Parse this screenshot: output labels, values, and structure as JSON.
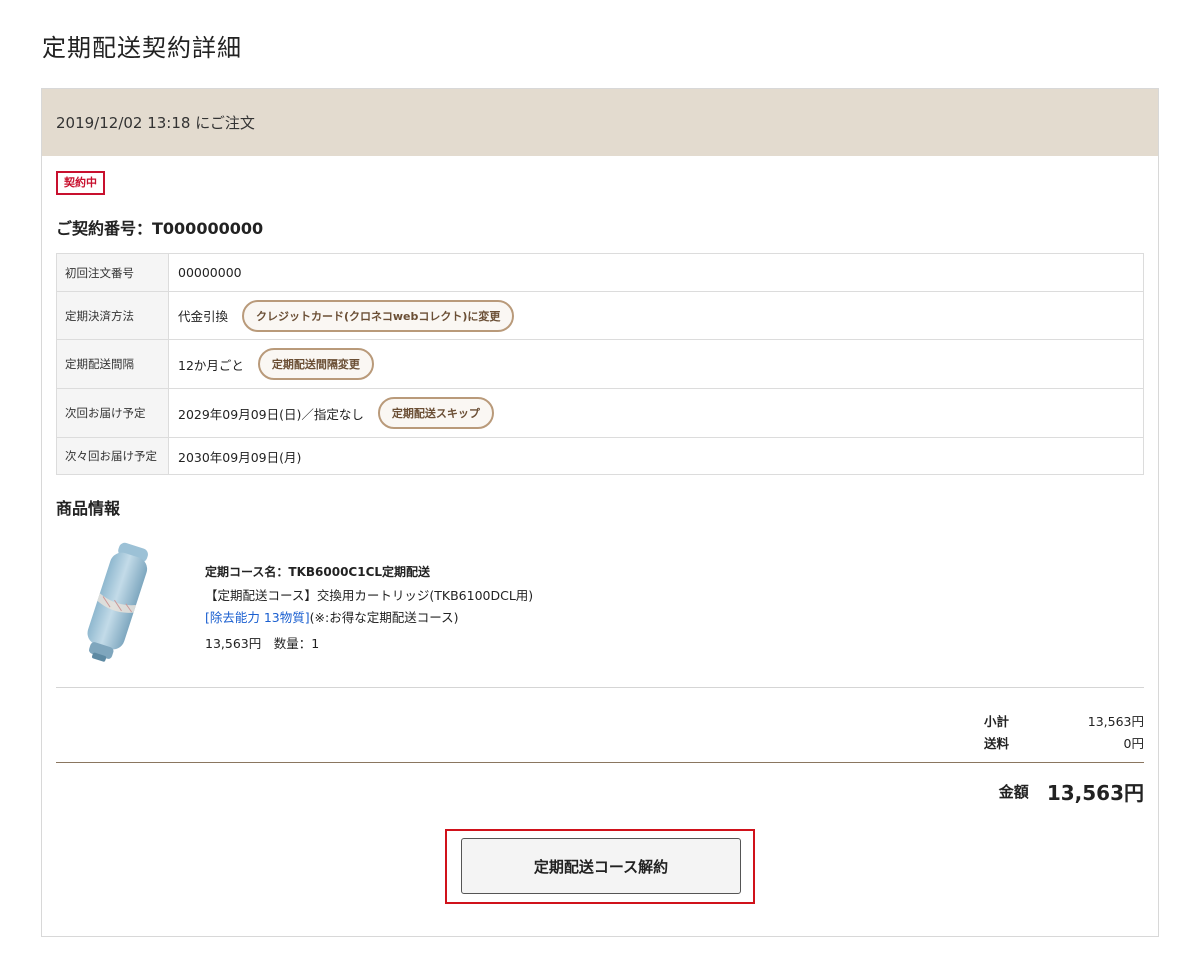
{
  "page": {
    "title": "定期配送契約詳細"
  },
  "order": {
    "header": "2019/12/02 13:18 にご注文",
    "status_badge": "契約中",
    "contract_number": "ご契約番号：T000000000"
  },
  "details": {
    "rows": [
      {
        "label": "初回注文番号",
        "value": "00000000"
      },
      {
        "label": "定期決済方法",
        "value": "代金引換",
        "button": "クレジットカード(クロネコwebコレクト)に変更"
      },
      {
        "label": "定期配送間隔",
        "value": "12か月ごと",
        "button": "定期配送間隔変更"
      },
      {
        "label": "次回お届け予定",
        "value": "2029年09月09日(日)／指定なし",
        "button": "定期配送スキップ"
      },
      {
        "label": "次々回お届け予定",
        "value": "2030年09月09日(月)"
      }
    ]
  },
  "product": {
    "section_title": "商品情報",
    "course_name": "定期コース名：TKB6000C1CL定期配送",
    "name": "【定期配送コース】交換用カートリッジ(TKB6100DCL用)",
    "link_text": "[除去能力 13物質]",
    "note": "(※:お得な定期配送コース)",
    "price_qty": "13,563円　数量：1"
  },
  "summary": {
    "subtotal_label": "小計",
    "subtotal_value": "13,563円",
    "shipping_label": "送料",
    "shipping_value": "0円",
    "total_label": "金額",
    "total_value": "13,563円"
  },
  "actions": {
    "cancel_label": "定期配送コース解約"
  }
}
